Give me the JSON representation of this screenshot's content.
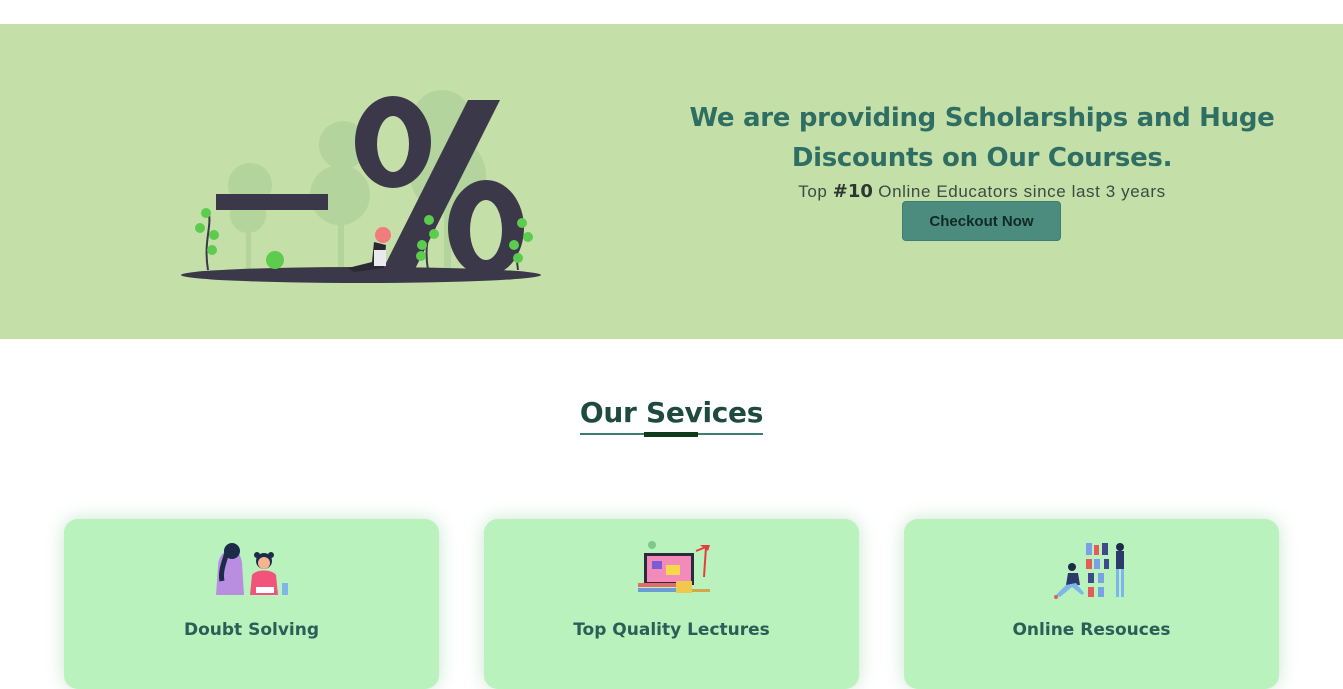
{
  "banner": {
    "title": "We are providing Scholarships and Huge Discounts on Our Courses.",
    "subtitle_prefix": "Top ",
    "subtitle_highlight": "#10",
    "subtitle_suffix": " Online Educators since last 3 years",
    "cta_label": "Checkout Now",
    "illustration": "discount-percent-illustration",
    "background_color": "#c5dfa9",
    "title_color": "#2f6e63",
    "cta_color": "#4b8c7e"
  },
  "services": {
    "heading": "Our Sevices",
    "cards": [
      {
        "title": "Doubt Solving",
        "icon": "doubt-solving-illustration"
      },
      {
        "title": "Top Quality Lectures",
        "icon": "lectures-illustration"
      },
      {
        "title": "Online Resouces",
        "icon": "online-resources-illustration"
      }
    ],
    "card_color": "#b9f2bd"
  }
}
